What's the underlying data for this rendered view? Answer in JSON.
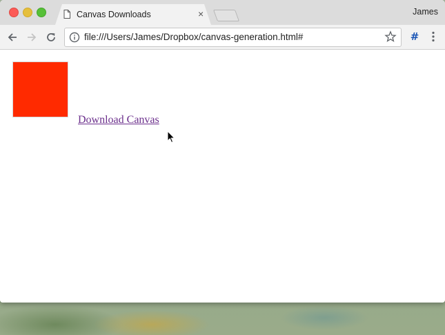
{
  "browser": {
    "tab": {
      "title": "Canvas Downloads"
    },
    "profile_name": "James",
    "address_bar": {
      "url": "file:///Users/James/Dropbox/canvas-generation.html#"
    },
    "extension_label": "#"
  },
  "page": {
    "canvas_color": "#ff2a00",
    "download_link_text": "Download Canvas"
  },
  "colors": {
    "link_visited": "#6b2f8c"
  }
}
